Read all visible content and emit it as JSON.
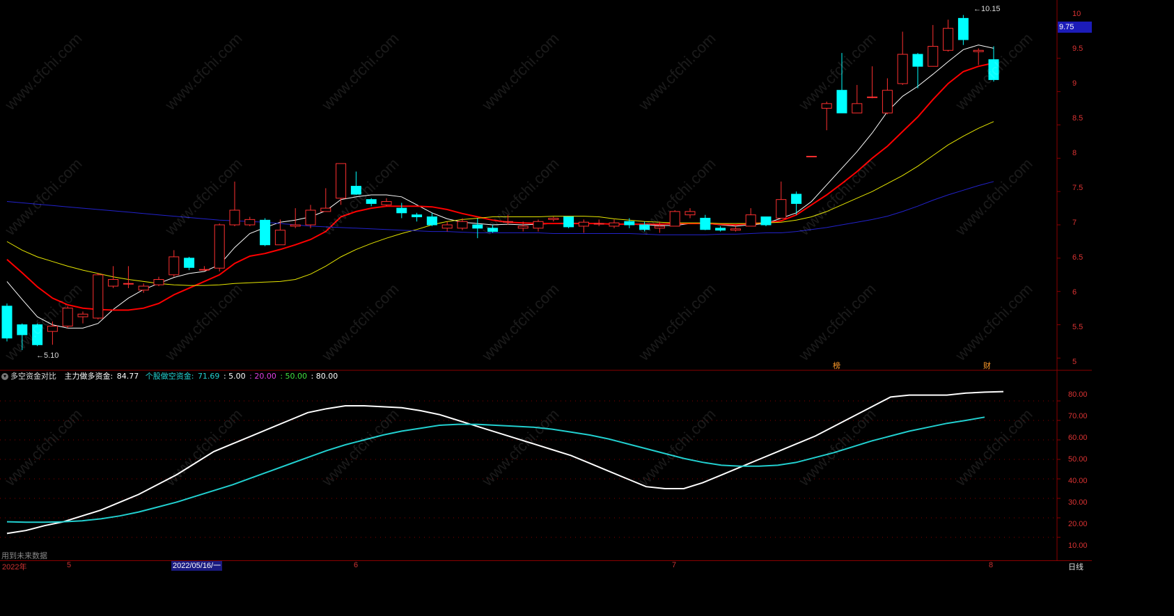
{
  "chart_data": [
    {
      "type": "candlestick",
      "x_range": [
        0,
        66
      ],
      "ylim": [
        4.9,
        10.25
      ],
      "y_ticks": [
        5.0,
        5.5,
        6.0,
        6.5,
        7.0,
        7.5,
        8.0,
        8.5,
        9.0,
        9.5,
        10.0
      ],
      "current_price": "9.75",
      "high_label": "10.15",
      "low_label": "5.10",
      "candles": [
        [
          5.78,
          5.3,
          5.82,
          5.25
        ],
        [
          5.5,
          5.35,
          5.52,
          5.12
        ],
        [
          5.5,
          5.2,
          5.52,
          5.18
        ],
        [
          5.4,
          5.48,
          5.55,
          5.2
        ],
        [
          5.48,
          5.75,
          5.78,
          5.45
        ],
        [
          5.62,
          5.66,
          5.7,
          5.52
        ],
        [
          5.6,
          6.25,
          6.28,
          5.58
        ],
        [
          6.08,
          6.18,
          6.38,
          6.05
        ],
        [
          6.12,
          6.12,
          6.38,
          6.05
        ],
        [
          6.02,
          6.08,
          6.12,
          5.98
        ],
        [
          6.1,
          6.18,
          6.22,
          6.08
        ],
        [
          6.25,
          6.52,
          6.62,
          6.22
        ],
        [
          6.5,
          6.36,
          6.52,
          6.32
        ],
        [
          6.33,
          6.33,
          6.38,
          6.33
        ],
        [
          6.35,
          7.0,
          7.02,
          6.3
        ],
        [
          7.0,
          7.22,
          7.65,
          6.98
        ],
        [
          7.0,
          7.08,
          7.12,
          6.98
        ],
        [
          7.07,
          6.7,
          7.1,
          6.68
        ],
        [
          6.7,
          6.92,
          7.08,
          6.7
        ],
        [
          6.98,
          7.0,
          7.25,
          6.95
        ],
        [
          7.0,
          7.22,
          7.3,
          6.95
        ],
        [
          7.2,
          7.25,
          7.55,
          7.2
        ],
        [
          7.4,
          7.92,
          7.92,
          7.3
        ],
        [
          7.58,
          7.46,
          7.8,
          7.45
        ],
        [
          7.38,
          7.32,
          7.4,
          7.28
        ],
        [
          7.3,
          7.35,
          7.4,
          7.28
        ],
        [
          7.25,
          7.18,
          7.33,
          7.1
        ],
        [
          7.15,
          7.12,
          7.18,
          7.05
        ],
        [
          7.12,
          7.0,
          7.18,
          6.98
        ],
        [
          6.95,
          7.0,
          7.05,
          6.9
        ],
        [
          6.95,
          7.05,
          7.1,
          6.92
        ],
        [
          7.0,
          6.95,
          7.1,
          6.8
        ],
        [
          6.95,
          6.9,
          7.0,
          6.88
        ],
        [
          7.05,
          7.05,
          7.15,
          7.0
        ],
        [
          6.95,
          6.98,
          7.05,
          6.9
        ],
        [
          6.95,
          7.05,
          7.08,
          6.9
        ],
        [
          7.08,
          7.1,
          7.12,
          7.05
        ],
        [
          7.12,
          6.97,
          7.12,
          6.95
        ],
        [
          6.98,
          7.04,
          7.08,
          6.88
        ],
        [
          7.02,
          7.02,
          7.08,
          6.98
        ],
        [
          6.98,
          7.03,
          7.08,
          6.95
        ],
        [
          7.05,
          7.0,
          7.1,
          6.95
        ],
        [
          7.0,
          6.93,
          7.05,
          6.9
        ],
        [
          6.95,
          6.98,
          7.05,
          6.88
        ],
        [
          6.98,
          7.2,
          7.22,
          6.98
        ],
        [
          7.15,
          7.2,
          7.25,
          7.1
        ],
        [
          7.1,
          6.93,
          7.15,
          6.92
        ],
        [
          6.95,
          6.92,
          6.98,
          6.9
        ],
        [
          6.92,
          6.94,
          6.98,
          6.9
        ],
        [
          6.98,
          7.15,
          7.25,
          6.98
        ],
        [
          7.12,
          7.0,
          7.12,
          6.98
        ],
        [
          7.1,
          7.38,
          7.65,
          7.1
        ],
        [
          7.46,
          7.32,
          7.5,
          7.15
        ],
        [
          8.03,
          8.03,
          8.03,
          8.03
        ],
        [
          8.75,
          8.82,
          8.85,
          8.42
        ],
        [
          9.02,
          8.68,
          9.58,
          8.68
        ],
        [
          8.68,
          8.82,
          9.1,
          8.68
        ],
        [
          8.92,
          8.92,
          9.38,
          8.9
        ],
        [
          8.68,
          9.02,
          9.2,
          8.66
        ],
        [
          9.12,
          9.56,
          9.9,
          9.1
        ],
        [
          9.56,
          9.38,
          9.58,
          9.05
        ],
        [
          9.38,
          9.68,
          10.0,
          9.38
        ],
        [
          9.62,
          9.95,
          10.08,
          9.6
        ],
        [
          10.1,
          9.78,
          10.15,
          9.7
        ],
        [
          9.6,
          9.62,
          9.65,
          9.4
        ],
        [
          9.48,
          9.18,
          9.68,
          9.15
        ]
      ],
      "series": [
        {
          "color": "#ffffff",
          "values": [
            6.15,
            5.88,
            5.62,
            5.5,
            5.45,
            5.45,
            5.52,
            5.73,
            5.9,
            6.03,
            6.12,
            6.21,
            6.27,
            6.3,
            6.4,
            6.66,
            6.87,
            6.96,
            7.04,
            7.07,
            7.12,
            7.21,
            7.38,
            7.42,
            7.45,
            7.45,
            7.42,
            7.3,
            7.18,
            7.09,
            7.04,
            7.02,
            7.0,
            7.01,
            7.0,
            7.01,
            7.02,
            7.03,
            7.02,
            7.02,
            7.01,
            7.01,
            7.0,
            6.99,
            6.99,
            7.02,
            7.02,
            7.0,
            6.98,
            7.0,
            7.02,
            7.1,
            7.18,
            7.35,
            7.6,
            7.85,
            8.1,
            8.38,
            8.7,
            8.93,
            9.08,
            9.26,
            9.45,
            9.63,
            9.7,
            9.65
          ]
        },
        {
          "color": "#ff0000",
          "values": [
            6.48,
            6.28,
            6.07,
            5.9,
            5.8,
            5.75,
            5.73,
            5.72,
            5.72,
            5.75,
            5.82,
            5.95,
            6.05,
            6.15,
            6.25,
            6.42,
            6.53,
            6.57,
            6.63,
            6.7,
            6.78,
            6.9,
            7.12,
            7.2,
            7.25,
            7.28,
            7.28,
            7.28,
            7.27,
            7.23,
            7.17,
            7.12,
            7.07,
            7.04,
            7.03,
            7.02,
            7.02,
            7.02,
            7.02,
            7.02,
            7.01,
            7.01,
            7.01,
            7.01,
            7.02,
            7.02,
            7.02,
            7.01,
            7.0,
            7.02,
            7.03,
            7.06,
            7.15,
            7.3,
            7.45,
            7.62,
            7.8,
            8.0,
            8.18,
            8.4,
            8.62,
            8.88,
            9.12,
            9.3,
            9.38,
            9.43
          ]
        },
        {
          "color": "#e8e800",
          "values": [
            6.75,
            6.62,
            6.52,
            6.45,
            6.38,
            6.32,
            6.27,
            6.22,
            6.18,
            6.15,
            6.12,
            6.1,
            6.09,
            6.09,
            6.1,
            6.12,
            6.13,
            6.14,
            6.15,
            6.18,
            6.26,
            6.38,
            6.52,
            6.63,
            6.72,
            6.8,
            6.87,
            6.93,
            7.0,
            7.05,
            7.08,
            7.1,
            7.12,
            7.12,
            7.12,
            7.12,
            7.13,
            7.13,
            7.13,
            7.12,
            7.09,
            7.07,
            7.05,
            7.04,
            7.03,
            7.03,
            7.03,
            7.02,
            7.02,
            7.02,
            7.03,
            7.04,
            7.07,
            7.12,
            7.2,
            7.3,
            7.4,
            7.5,
            7.62,
            7.74,
            7.88,
            8.04,
            8.2,
            8.33,
            8.45,
            8.55
          ]
        },
        {
          "color": "#2222cc",
          "values": [
            7.35,
            7.33,
            7.31,
            7.29,
            7.27,
            7.25,
            7.23,
            7.21,
            7.19,
            7.17,
            7.15,
            7.13,
            7.11,
            7.09,
            7.07,
            7.06,
            7.05,
            7.04,
            7.02,
            7.0,
            6.98,
            6.97,
            6.96,
            6.95,
            6.94,
            6.93,
            6.92,
            6.91,
            6.9,
            6.9,
            6.89,
            6.88,
            6.88,
            6.88,
            6.88,
            6.88,
            6.87,
            6.87,
            6.87,
            6.87,
            6.87,
            6.87,
            6.86,
            6.85,
            6.85,
            6.85,
            6.85,
            6.86,
            6.86,
            6.87,
            6.88,
            6.88,
            6.9,
            6.93,
            6.96,
            7.0,
            7.04,
            7.08,
            7.13,
            7.2,
            7.28,
            7.37,
            7.45,
            7.52,
            7.59,
            7.65
          ]
        }
      ]
    },
    {
      "type": "line",
      "ylim": [
        0,
        90
      ],
      "y_ticks": [
        "10.00",
        "20.00",
        "30.00",
        "40.00",
        "50.00",
        "60.00",
        "70.00",
        "80.00"
      ],
      "series": [
        {
          "name": "主力做多资金",
          "color": "#ffffff",
          "values": [
            12,
            13.5,
            16,
            18,
            21,
            24,
            28,
            32,
            37,
            42,
            48,
            54,
            58,
            62,
            66,
            70,
            74,
            76,
            77.5,
            77.5,
            77,
            76.5,
            75,
            73,
            70,
            67,
            64,
            61,
            58,
            55,
            52,
            48,
            44,
            40,
            36,
            35,
            35,
            38,
            42,
            46,
            50,
            54,
            58,
            62,
            67,
            72,
            77,
            82,
            83,
            83,
            83,
            84,
            84.5,
            84.77
          ]
        },
        {
          "name": "个股做空资金",
          "color": "#22d0d0",
          "values": [
            18,
            17.8,
            17.8,
            18,
            18.5,
            19.5,
            21,
            23,
            25.5,
            28,
            31,
            34,
            37,
            40.5,
            44,
            47.5,
            51,
            54.5,
            57.5,
            60,
            62.5,
            64.5,
            66,
            67.5,
            68,
            68,
            67.5,
            67,
            66.5,
            65.5,
            64,
            62.5,
            60.5,
            58,
            55.5,
            53,
            50.5,
            48.5,
            47,
            46.5,
            46.5,
            47,
            48.5,
            51,
            53.5,
            56.5,
            59.5,
            62,
            64.5,
            66.5,
            68.5,
            70,
            71.69
          ]
        }
      ]
    }
  ],
  "indicator_legend": {
    "name": "多空资金对比",
    "long_label": "主力做多资金:",
    "long_value": "84.77",
    "short_label": "个股做空资金:",
    "short_value": "71.69",
    "level1": ": 5.00",
    "level2": ": 20.00",
    "level3": ": 50.00",
    "level4": ": 80.00"
  },
  "flags": {
    "bang": "榜",
    "cai": "财"
  },
  "future_data_note": "用到未来数据",
  "x_axis": {
    "year": "2022年",
    "m5": "5",
    "m6": "6",
    "m7": "7",
    "m8": "8",
    "cursor_date": "2022/05/16/一",
    "period": "日线"
  },
  "watermark": "www.cfchi.com",
  "colors": {
    "up": "#ff3030",
    "down": "#00ffff",
    "grid": "#8b0000",
    "axis_text": "#dd3333"
  }
}
